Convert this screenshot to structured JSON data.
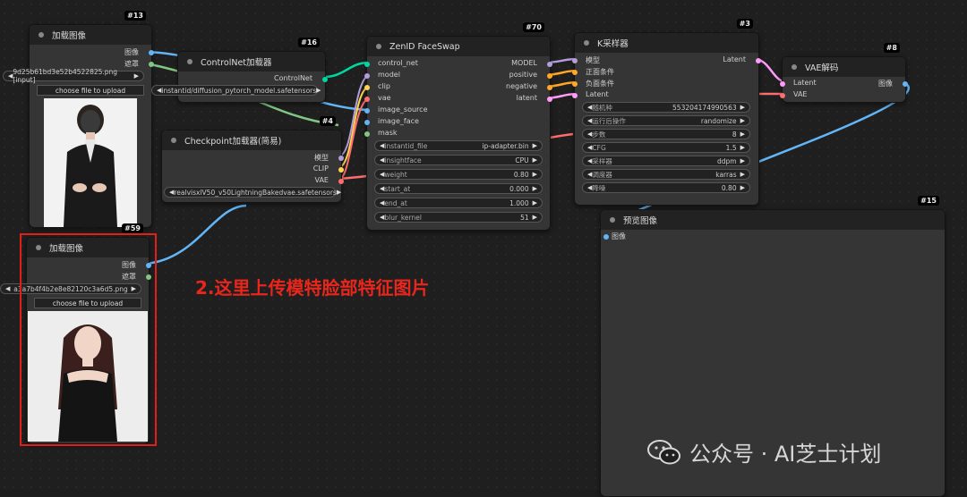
{
  "nodes": {
    "load1": {
      "id": "#13",
      "title": "加载图像",
      "out_image": "图像",
      "out_mask": "遮罩",
      "file": "9d25b61bd3e52b4522825.png [input]",
      "upload": "choose file to upload"
    },
    "controlnet": {
      "id": "#16",
      "title": "ControlNet加载器",
      "out": "ControlNet",
      "file": "instantid/diffusion_pytorch_model.safetensors"
    },
    "checkpoint": {
      "id": "#4",
      "title": "Checkpoint加载器(简易)",
      "out_model": "模型",
      "out_clip": "CLIP",
      "out_vae": "VAE",
      "file": "realvisxlV50_v50LightningBakedvae.safetensors"
    },
    "load2": {
      "id": "#59",
      "title": "加载图像",
      "out_image": "图像",
      "out_mask": "遮罩",
      "file": "a3a7b4f4b2e8e82120c3a6d5.png",
      "upload": "choose file to upload"
    },
    "zenid": {
      "id": "#70",
      "title": "ZenID FaceSwap",
      "inputs": [
        "control_net",
        "model",
        "clip",
        "vae",
        "image_source",
        "image_face",
        "mask"
      ],
      "outputs": [
        "MODEL",
        "positive",
        "negative",
        "latent"
      ],
      "widgets": [
        {
          "label": "instantid_file",
          "value": "ip-adapter.bin"
        },
        {
          "label": "insightface",
          "value": "CPU"
        },
        {
          "label": "weight",
          "value": "0.80"
        },
        {
          "label": "start_at",
          "value": "0.000"
        },
        {
          "label": "end_at",
          "value": "1.000"
        },
        {
          "label": "blur_kernel",
          "value": "51"
        }
      ]
    },
    "ksampler": {
      "id": "#3",
      "title": "K采样器",
      "inputs": [
        "模型",
        "正面条件",
        "负面条件",
        "Latent"
      ],
      "output": "Latent",
      "widgets": [
        {
          "label": "随机种",
          "value": "553204174990563"
        },
        {
          "label": "运行后操作",
          "value": "randomize"
        },
        {
          "label": "步数",
          "value": "8"
        },
        {
          "label": "CFG",
          "value": "1.5"
        },
        {
          "label": "采样器",
          "value": "ddpm"
        },
        {
          "label": "调度器",
          "value": "karras"
        },
        {
          "label": "降噪",
          "value": "0.80"
        }
      ]
    },
    "vae": {
      "id": "#8",
      "title": "VAE解码",
      "in_latent": "Latent",
      "in_vae": "VAE",
      "out": "图像"
    },
    "preview": {
      "id": "#15",
      "title": "预览图像",
      "in": "图像"
    }
  },
  "annotation": "2.这里上传模特脸部特征图片",
  "watermark": "公众号 · AI芝士计划",
  "colors": {
    "annotation": "#e8261c",
    "model": "#b39ddb",
    "clip": "#ffd54f",
    "vae": "#ff6e6e",
    "image": "#64b5f6",
    "mask": "#81c784",
    "conditioning": "#ffa726",
    "latent": "#ff9cf9",
    "controlnet": "#00d7a0"
  }
}
